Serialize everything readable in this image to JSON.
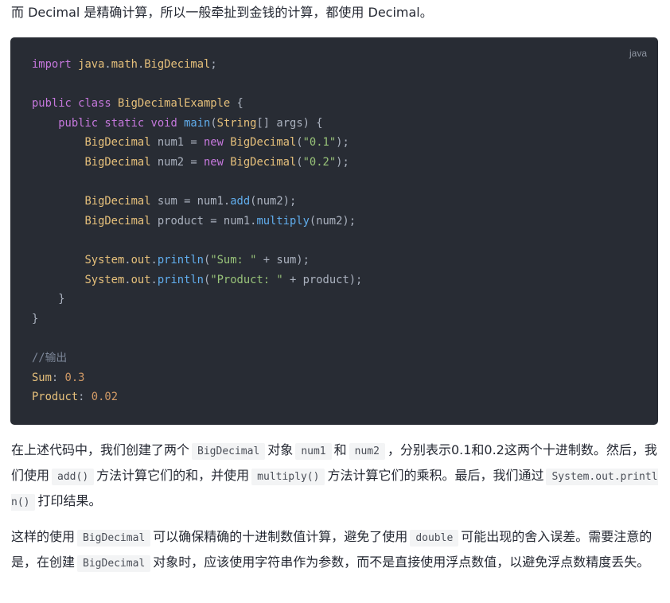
{
  "intro": "而 Decimal 是精确计算，所以一般牵扯到金钱的计算，都使用 Decimal。",
  "code_block": {
    "language": "java",
    "lines": [
      [
        [
          "kw",
          "import "
        ],
        [
          "ty",
          "java"
        ],
        [
          "tx",
          "."
        ],
        [
          "ty",
          "math"
        ],
        [
          "tx",
          "."
        ],
        [
          "ty",
          "BigDecimal"
        ],
        [
          "tx",
          ";"
        ]
      ],
      [],
      [
        [
          "kw",
          "public "
        ],
        [
          "kw",
          "class "
        ],
        [
          "ty",
          "BigDecimalExample"
        ],
        [
          "tx",
          " {"
        ]
      ],
      [
        [
          "tx",
          "    "
        ],
        [
          "kw",
          "public "
        ],
        [
          "kw",
          "static "
        ],
        [
          "kw",
          "void "
        ],
        [
          "fn",
          "main"
        ],
        [
          "tx",
          "("
        ],
        [
          "ty",
          "String"
        ],
        [
          "tx",
          "[] args) {"
        ]
      ],
      [
        [
          "tx",
          "        "
        ],
        [
          "ty",
          "BigDecimal"
        ],
        [
          "tx",
          " num1 = "
        ],
        [
          "kw",
          "new "
        ],
        [
          "ty",
          "BigDecimal"
        ],
        [
          "tx",
          "("
        ],
        [
          "st",
          "\"0.1\""
        ],
        [
          "tx",
          ");"
        ]
      ],
      [
        [
          "tx",
          "        "
        ],
        [
          "ty",
          "BigDecimal"
        ],
        [
          "tx",
          " num2 = "
        ],
        [
          "kw",
          "new "
        ],
        [
          "ty",
          "BigDecimal"
        ],
        [
          "tx",
          "("
        ],
        [
          "st",
          "\"0.2\""
        ],
        [
          "tx",
          ");"
        ]
      ],
      [],
      [
        [
          "tx",
          "        "
        ],
        [
          "ty",
          "BigDecimal"
        ],
        [
          "tx",
          " sum = num1."
        ],
        [
          "fn",
          "add"
        ],
        [
          "tx",
          "(num2);"
        ]
      ],
      [
        [
          "tx",
          "        "
        ],
        [
          "ty",
          "BigDecimal"
        ],
        [
          "tx",
          " product = num1."
        ],
        [
          "fn",
          "multiply"
        ],
        [
          "tx",
          "(num2);"
        ]
      ],
      [],
      [
        [
          "tx",
          "        "
        ],
        [
          "ty",
          "System"
        ],
        [
          "tx",
          "."
        ],
        [
          "ty",
          "out"
        ],
        [
          "tx",
          "."
        ],
        [
          "fn",
          "println"
        ],
        [
          "tx",
          "("
        ],
        [
          "st",
          "\"Sum: \""
        ],
        [
          "tx",
          " + sum);"
        ]
      ],
      [
        [
          "tx",
          "        "
        ],
        [
          "ty",
          "System"
        ],
        [
          "tx",
          "."
        ],
        [
          "ty",
          "out"
        ],
        [
          "tx",
          "."
        ],
        [
          "fn",
          "println"
        ],
        [
          "tx",
          "("
        ],
        [
          "st",
          "\"Product: \""
        ],
        [
          "tx",
          " + product);"
        ]
      ],
      [
        [
          "tx",
          "    }"
        ]
      ],
      [
        [
          "tx",
          "}"
        ]
      ],
      [],
      [
        [
          "cm",
          "//输出"
        ]
      ],
      [
        [
          "out-key",
          "Sum"
        ],
        [
          "tx",
          ": "
        ],
        [
          "out-val",
          "0.3"
        ]
      ],
      [
        [
          "out-key",
          "Product"
        ],
        [
          "tx",
          ": "
        ],
        [
          "out-val",
          "0.02"
        ]
      ]
    ]
  },
  "paragraph1": [
    [
      "t",
      "在上述代码中，我们创建了两个"
    ],
    [
      "c",
      "BigDecimal"
    ],
    [
      "t",
      "对象"
    ],
    [
      "c",
      "num1"
    ],
    [
      "t",
      "和"
    ],
    [
      "c",
      "num2"
    ],
    [
      "t",
      "，分别表示0.1和0.2这两个十进制数。然后，我们使用"
    ],
    [
      "c",
      "add()"
    ],
    [
      "t",
      "方法计算它们的和，并使用"
    ],
    [
      "c",
      "multiply()"
    ],
    [
      "t",
      "方法计算它们的乘积。最后，我们通过"
    ],
    [
      "c",
      "System.out.println()"
    ],
    [
      "t",
      "打印结果。"
    ]
  ],
  "paragraph2": [
    [
      "t",
      "这样的使用"
    ],
    [
      "c",
      "BigDecimal"
    ],
    [
      "t",
      "可以确保精确的十进制数值计算，避免了使用"
    ],
    [
      "c",
      "double"
    ],
    [
      "t",
      "可能出现的舍入误差。需要注意的是，在创建"
    ],
    [
      "c",
      "BigDecimal"
    ],
    [
      "t",
      "对象时，应该使用字符串作为参数，而不是直接使用浮点数值，以避免浮点数精度丢失。"
    ]
  ]
}
